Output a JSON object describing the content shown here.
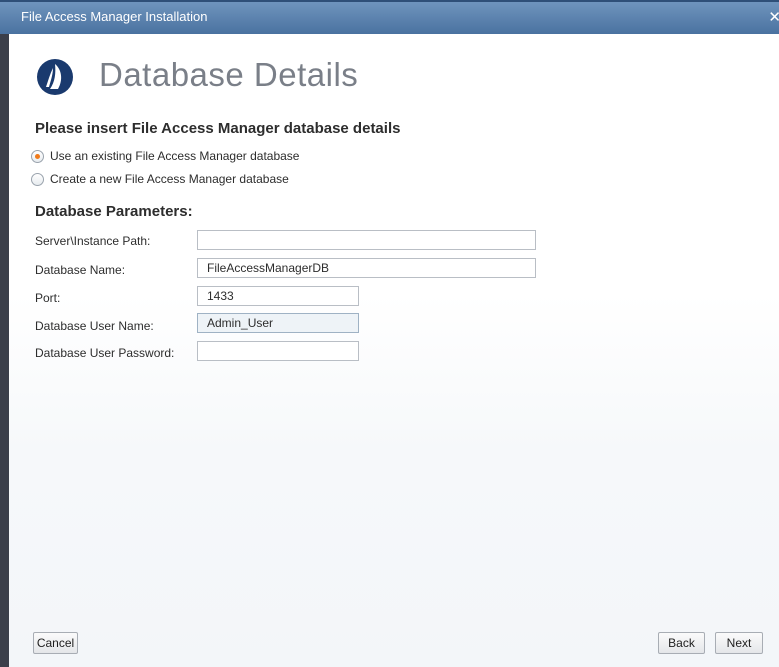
{
  "window": {
    "title": "File Access Manager Installation"
  },
  "header": {
    "title": "Database Details",
    "logo_icon": "sail-logo-icon",
    "logo_color": "#1a3a6e"
  },
  "subtitle": "Please insert File Access Manager database details",
  "options": [
    {
      "label": "Use an existing File Access Manager database",
      "selected": true
    },
    {
      "label": "Create a new File Access Manager database",
      "selected": false
    }
  ],
  "parameters": {
    "title": "Database Parameters:",
    "fields": [
      {
        "label": "Server\\Instance Path:",
        "value": ""
      },
      {
        "label": "Database Name:",
        "value": "FileAccessManagerDB"
      },
      {
        "label": "Port:",
        "value": "1433"
      },
      {
        "label": "Database User Name:",
        "value": "Admin_User"
      },
      {
        "label": "Database User Password:",
        "value": ""
      }
    ]
  },
  "buttons": {
    "cancel": "Cancel",
    "back": "Back",
    "next": "Next"
  },
  "colors": {
    "titlebar": "#4a72a0",
    "radio_accent": "#f07a1b"
  }
}
